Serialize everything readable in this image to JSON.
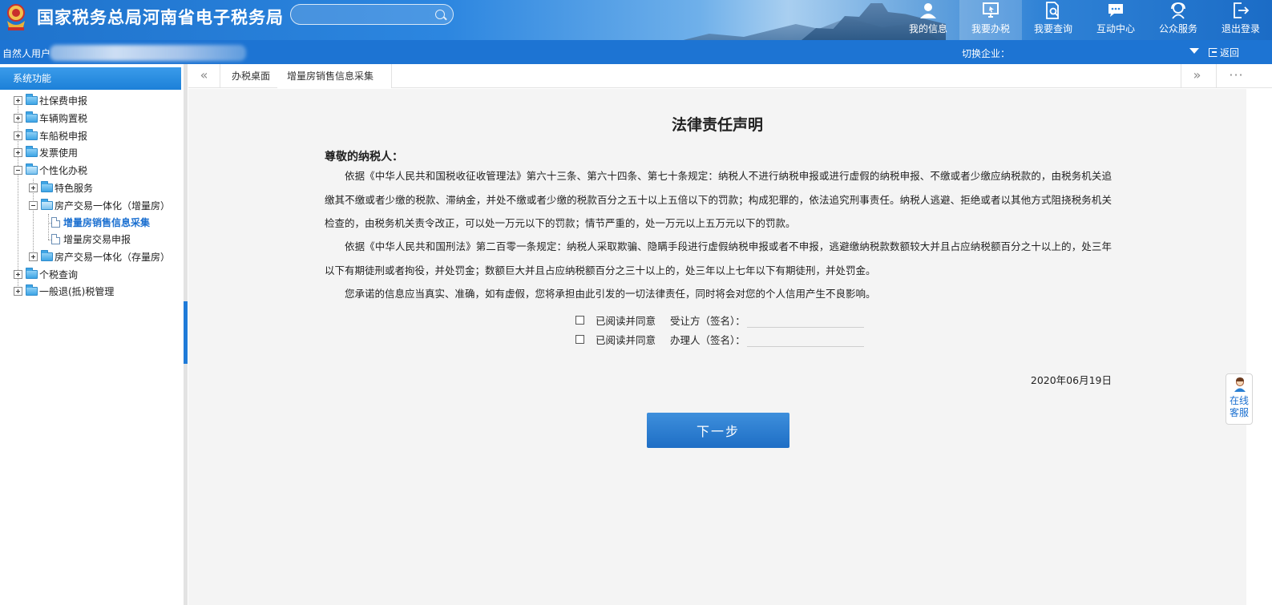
{
  "header": {
    "title": "国家税务总局河南省电子税务局",
    "search_placeholder": "",
    "nav": [
      {
        "label": "我的信息",
        "icon": "user-icon"
      },
      {
        "label": "我要办税",
        "icon": "monitor-pointer-icon",
        "active": true
      },
      {
        "label": "我要查询",
        "icon": "document-search-icon"
      },
      {
        "label": "互动中心",
        "icon": "chat-bubble-icon"
      },
      {
        "label": "公众服务",
        "icon": "service-person-icon"
      },
      {
        "label": "退出登录",
        "icon": "logout-icon"
      }
    ]
  },
  "subbar": {
    "user_label": "自然人用户",
    "switch_label": "切换企业：",
    "back_label": "返回"
  },
  "sidebar": {
    "header": "系统功能",
    "items": [
      {
        "label": "社保费申报",
        "expander": "plus"
      },
      {
        "label": "车辆购置税",
        "expander": "plus"
      },
      {
        "label": "车船税申报",
        "expander": "plus"
      },
      {
        "label": "发票使用",
        "expander": "plus"
      },
      {
        "label": "个性化办税",
        "expander": "minus"
      },
      {
        "label": "特色服务",
        "expander": "plus"
      },
      {
        "label": "房产交易一体化（增量房）",
        "expander": "minus"
      },
      {
        "label": "增量房销售信息采集",
        "selected": true
      },
      {
        "label": "增量房交易申报"
      },
      {
        "label": "房产交易一体化（存量房）",
        "expander": "plus"
      },
      {
        "label": "个税查询",
        "expander": "plus"
      },
      {
        "label": "一般退(抵)税管理",
        "expander": "plus"
      }
    ]
  },
  "tabs": {
    "prev": "«",
    "next": "»",
    "more": "···",
    "items": [
      {
        "label": "办税桌面"
      },
      {
        "label": "增量房销售信息采集",
        "active": true
      }
    ]
  },
  "document": {
    "title": "法律责任声明",
    "greeting": "尊敬的纳税人：",
    "paragraphs": [
      "依据《中华人民共和国税收征收管理法》第六十三条、第六十四条、第七十条规定：纳税人不进行纳税申报或进行虚假的纳税申报、不缴或者少缴应纳税款的，由税务机关追缴其不缴或者少缴的税款、滞纳金，并处不缴或者少缴的税款百分之五十以上五倍以下的罚款；构成犯罪的，依法追究刑事责任。纳税人逃避、拒绝或者以其他方式阻挠税务机关检查的，由税务机关责令改正，可以处一万元以下的罚款；情节严重的，处一万元以上五万元以下的罚款。",
      "依据《中华人民共和国刑法》第二百零一条规定：纳税人采取欺骗、隐瞒手段进行虚假纳税申报或者不申报，逃避缴纳税款数额较大并且占应纳税额百分之十以上的，处三年以下有期徒刑或者拘役，并处罚金；数额巨大并且占应纳税额百分之三十以上的，处三年以上七年以下有期徒刑，并处罚金。",
      "您承诺的信息应当真实、准确，如有虚假，您将承担由此引发的一切法律责任，同时将会对您的个人信用产生不良影响。"
    ],
    "agreements": [
      {
        "agree_label": "已阅读并同意",
        "party_label": "受让方（签名）：",
        "value": ""
      },
      {
        "agree_label": "已阅读并同意",
        "party_label": "办理人（签名）：",
        "value": ""
      }
    ],
    "date": "2020年06月19日",
    "next_button": "下一步"
  },
  "online_service": {
    "label": "在线客服",
    "icon": "customer-service-avatar-icon"
  },
  "colors": {
    "brand_blue": "#1d74d3",
    "selected_text": "#1a6fd0",
    "button_blue": "#2a7fd2"
  }
}
